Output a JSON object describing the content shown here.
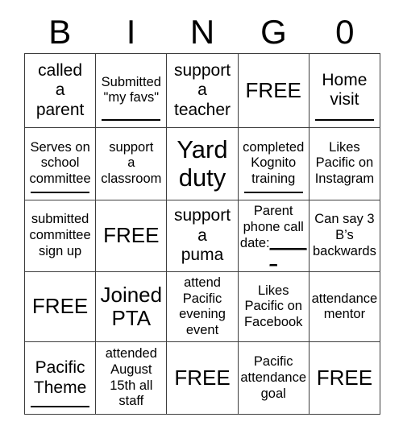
{
  "card": {
    "title_letters": [
      "B",
      "I",
      "N",
      "G",
      "0"
    ],
    "free_label": "FREE",
    "rows": [
      [
        {
          "text": "called\na\nparent",
          "size": "fs-md",
          "blank": false,
          "free": false
        },
        {
          "text": "Submitted\n\"my favs\"",
          "size": "fs-sm",
          "blank": true,
          "free": false
        },
        {
          "text": "support\na\nteacher",
          "size": "fs-md",
          "blank": false,
          "free": false
        },
        {
          "text": "FREE",
          "size": "fs-lg",
          "blank": false,
          "free": true
        },
        {
          "text": "Home\nvisit",
          "size": "fs-md",
          "blank": true,
          "free": false
        }
      ],
      [
        {
          "text": "Serves on\nschool\ncommittee",
          "size": "fs-sm",
          "blank": true,
          "free": false
        },
        {
          "text": "support\na\nclassroom",
          "size": "fs-sm",
          "blank": false,
          "free": false
        },
        {
          "text": "Yard\nduty",
          "size": "fs-xl",
          "blank": false,
          "free": false
        },
        {
          "text": "completed\nKognito\ntraining",
          "size": "fs-sm",
          "blank": true,
          "free": false
        },
        {
          "text": "Likes\nPacific on\nInstagram",
          "size": "fs-sm",
          "blank": false,
          "free": false
        }
      ],
      [
        {
          "text": "submitted\ncommittee\nsign up",
          "size": "fs-sm",
          "blank": false,
          "free": false
        },
        {
          "text": "FREE",
          "size": "fs-lg",
          "blank": false,
          "free": true
        },
        {
          "text": "support\na\npuma",
          "size": "fs-md",
          "blank": false,
          "free": false
        },
        {
          "text": "Parent\nphone call\ndate:",
          "size": "fs-sm",
          "blank": false,
          "free": false,
          "inline_blank": "______"
        },
        {
          "text": "Can say 3\nB’s\nbackwards",
          "size": "fs-sm",
          "blank": false,
          "free": false
        }
      ],
      [
        {
          "text": "FREE",
          "size": "fs-lg",
          "blank": false,
          "free": true
        },
        {
          "text": "Joined\nPTA",
          "size": "fs-lg",
          "blank": false,
          "free": false
        },
        {
          "text": "attend\nPacific\nevening\nevent",
          "size": "fs-sm",
          "blank": false,
          "free": false
        },
        {
          "text": "Likes\nPacific on\nFacebook",
          "size": "fs-sm",
          "blank": false,
          "free": false
        },
        {
          "text": "attendance\nmentor",
          "size": "fs-sm",
          "blank": false,
          "free": false
        }
      ],
      [
        {
          "text": "Pacific\nTheme",
          "size": "fs-md",
          "blank": true,
          "free": false
        },
        {
          "text": "attended\nAugust\n15th all\nstaff",
          "size": "fs-sm",
          "blank": false,
          "free": false
        },
        {
          "text": "FREE",
          "size": "fs-lg",
          "blank": false,
          "free": true
        },
        {
          "text": "Pacific\nattendance\ngoal",
          "size": "fs-sm",
          "blank": false,
          "free": false
        },
        {
          "text": "FREE",
          "size": "fs-lg",
          "blank": false,
          "free": true
        }
      ]
    ]
  }
}
